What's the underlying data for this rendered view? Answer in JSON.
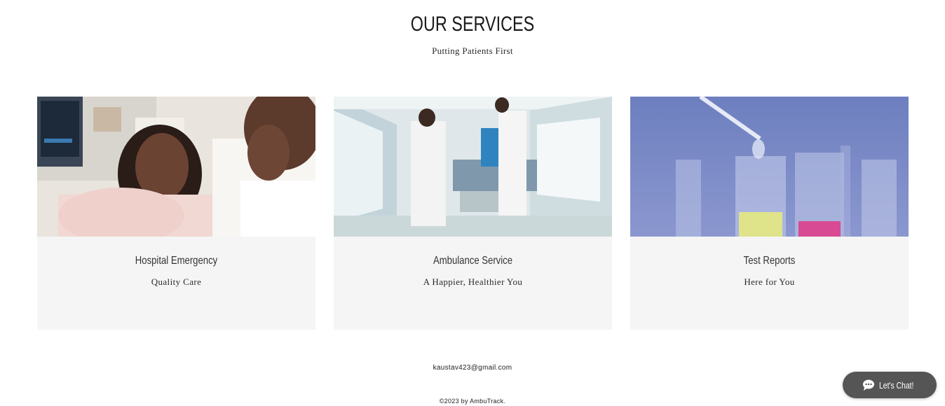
{
  "section": {
    "title": "OUR SERVICES",
    "subtitle": "Putting Patients First"
  },
  "cards": [
    {
      "title": "Hospital Emergency",
      "subtitle": "Quality Care",
      "image": "photo-pregnant-woman-ultrasound"
    },
    {
      "title": "Ambulance Service",
      "subtitle": "A Happier, Healthier You",
      "image": "photo-hospital-stretcher-corridor"
    },
    {
      "title": "Test Reports",
      "subtitle": "Here for You",
      "image": "photo-lab-test-tubes"
    }
  ],
  "footer": {
    "email": "kaustav423@gmail.com",
    "copyright": "©2023 by AmbuTrack."
  },
  "chat": {
    "label": "Let's Chat!",
    "icon": "chat-bubble-icon"
  },
  "colors": {
    "card_background": "#f5f5f5",
    "chat_background": "#555555"
  }
}
